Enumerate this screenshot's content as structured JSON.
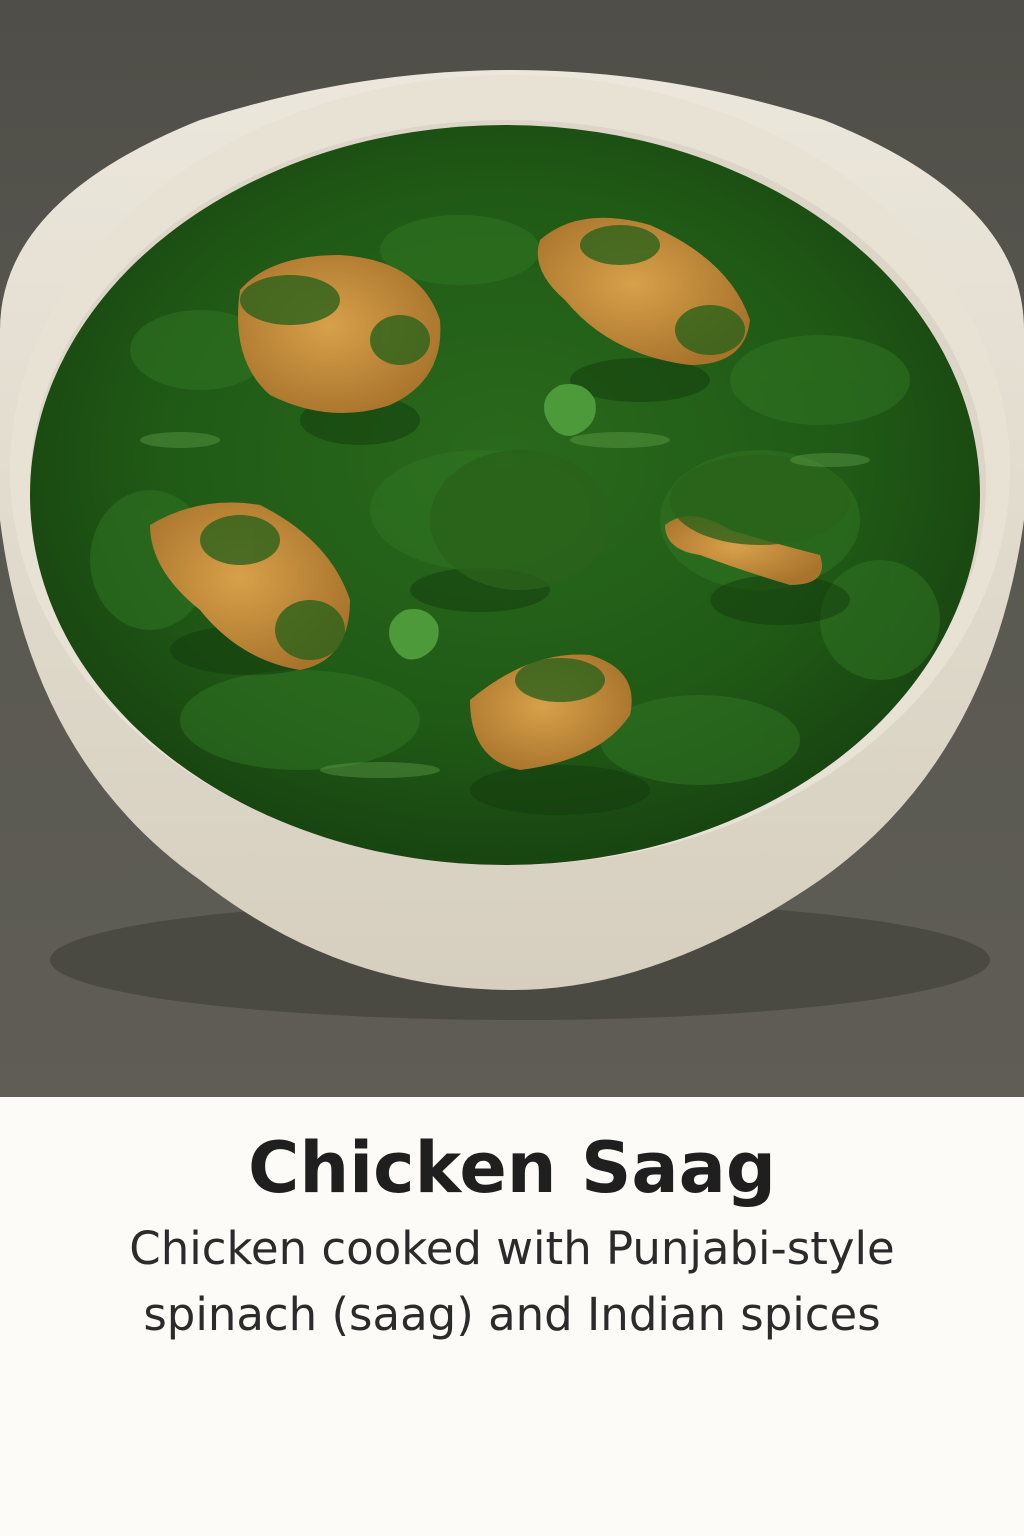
{
  "dish": {
    "title": "Chicken Saag",
    "description_line1": "Chicken cooked with Punjabi-style",
    "description_line2": "spinach (saag) and Indian spices"
  },
  "colors": {
    "background_table": "#55554d",
    "bowl": "#e3ddd0",
    "saag": "#1f5a17",
    "chicken": "#c9913d",
    "caption_background": "#fcfbf7",
    "title_text": "#1f1f1f"
  }
}
